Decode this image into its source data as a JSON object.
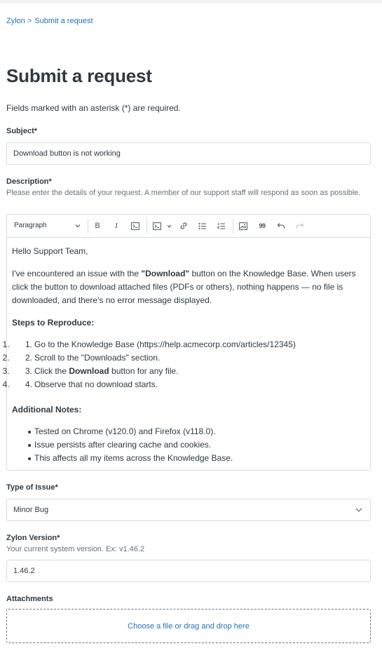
{
  "breadcrumb": {
    "home": "Zylon",
    "separator": ">",
    "current": "Submit a request"
  },
  "page": {
    "title": "Submit a request",
    "intro": "Fields marked with an asterisk (*) are required."
  },
  "subject": {
    "label": "Subject*",
    "value": "Download button is not working"
  },
  "description": {
    "label": "Description*",
    "hint": "Please enter the details of your request. A member of our support staff will respond as soon as possible.",
    "toolbar": {
      "paragraph_select": "Paragraph",
      "bold": "B",
      "italic": "I",
      "quote": "99"
    },
    "body": {
      "greeting": "Hello Support Team,",
      "intro_before": "I've encountered an issue with the ",
      "intro_bold": "\"Download\"",
      "intro_after": " button on the Knowledge Base. When users click the button to download attached files (PDFs or others), nothing happens — no file is downloaded, and there's no error message displayed.",
      "steps_heading": "Steps to Reproduce:",
      "steps": [
        {
          "num": "1.",
          "text": "Go to the Knowledge Base (https://help.acmecorp.com/articles/12345)"
        },
        {
          "num": "2.",
          "text": "Scroll to the \"Downloads\" section."
        },
        {
          "num": "3.",
          "pre": "Click the ",
          "bold": "Download",
          "post": " button for any file."
        },
        {
          "num": "4.",
          "text": "Observe that no download starts."
        }
      ],
      "notes_heading": "Additional Notes:",
      "notes": [
        "Tested on Chrome (v120.0) and Firefox (v118.0).",
        "Issue persists after clearing cache and cookies.",
        "This affects all my items across the Knowledge Base."
      ]
    }
  },
  "issue_type": {
    "label": "Type of Issue*",
    "value": "Minor Bug"
  },
  "version": {
    "label": "Zylon Version*",
    "hint": "Your current system version. Ex: v1.46.2",
    "value": "1.46.2"
  },
  "attachments": {
    "label": "Attachments",
    "dropzone_text": "Choose a file or drag and drop here"
  },
  "colors": {
    "link": "#1f73b7",
    "text": "#2f3941",
    "muted": "#68737d",
    "border": "#d8dcde"
  }
}
